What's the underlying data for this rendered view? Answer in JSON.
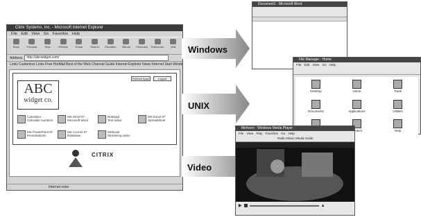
{
  "browser": {
    "title": "Citrix Systems, Inc. - Microsoft Internet Explorer",
    "menu": [
      "File",
      "Edit",
      "View",
      "Go",
      "Favorites",
      "Help"
    ],
    "toolbar": [
      "Back",
      "Forward",
      "Stop",
      "Refresh",
      "Home",
      "Search",
      "Favorites",
      "History",
      "Channels",
      "Fullscreen",
      "Mail"
    ],
    "address_label": "Address",
    "address_value": "http://abcwidget.com/",
    "links": "Links  Customize Links  Free HotMail  Best of the Web  Channel Guide  Internet Explorer News  Internet Start  Windows Update",
    "logo_line1": "ABC",
    "logo_line2": "widget co.",
    "top_buttons": [
      "Refresh Apps",
      "Logout"
    ],
    "apps": [
      {
        "name": "Calculator",
        "desc": "Calculate numbers"
      },
      {
        "name": "MS Word 97",
        "desc": "Microsoft Word"
      },
      {
        "name": "Notepad",
        "desc": "Text editor"
      },
      {
        "name": "MS Excel 97",
        "desc": "Spreadsheet"
      },
      {
        "name": "MS PowerPoint 97",
        "desc": "Presentations"
      },
      {
        "name": "MS Access 97",
        "desc": "Database"
      },
      {
        "name": "Webcast",
        "desc": "Streaming video"
      }
    ],
    "status": "Internet zone"
  },
  "labels": {
    "windows": "Windows",
    "unix": "UNIX",
    "video": "Video"
  },
  "windows_app": {
    "title": "Document1 - Microsoft Word"
  },
  "unix_app": {
    "title": "File Manager - Home",
    "menu": [
      "File",
      "Edit",
      "View",
      "Go",
      "Help"
    ],
    "icons": [
      "Desktop",
      "Home",
      "Trash",
      "Documents",
      "Applications",
      "Utilities",
      "Network",
      "Printers",
      "Help"
    ]
  },
  "video_app": {
    "title": "MeKeen - Windows Media Player",
    "menu": [
      "File",
      "View",
      "Play",
      "Favorites",
      "Go",
      "Help"
    ],
    "toolbar_text": "Radio   Music   Media Guide"
  }
}
